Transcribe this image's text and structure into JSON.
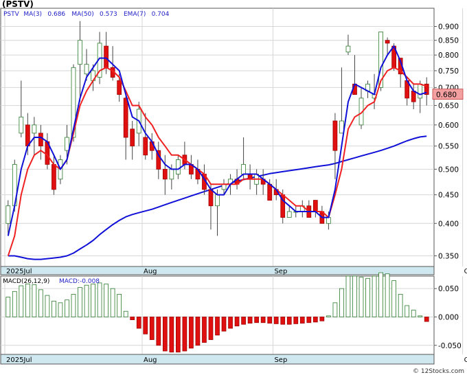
{
  "chart_data": [
    {
      "type": "candlestick",
      "title": "(PSTV)",
      "indicator_legend": [
        {
          "label": "PSTV",
          "color": "#1c1cc8"
        },
        {
          "label": "MA(3)",
          "color": "#1c1cc8"
        },
        {
          "label": "0.686",
          "color": "#1c1cc8"
        },
        {
          "label": "MA(50)",
          "color": "#1c1cc8"
        },
        {
          "label": "0.573",
          "color": "#1c1cc8"
        },
        {
          "label": "EMA(7)",
          "color": "#1c1cc8"
        },
        {
          "label": "0.704",
          "color": "#1c1cc8"
        }
      ],
      "x_tick_labels": [
        {
          "label": "2025Jul",
          "index": 0
        },
        {
          "label": "Aug",
          "index": 21
        },
        {
          "label": "Sep",
          "index": 41
        },
        {
          "label": "Oct",
          "index": 70
        }
      ],
      "y_ticks": [
        0.35,
        0.4,
        0.45,
        0.5,
        0.55,
        0.6,
        0.65,
        0.7,
        0.75,
        0.8,
        0.85,
        0.9
      ],
      "y_tick_labels": [
        "0.350",
        "0.400",
        "0.450",
        "0.500",
        "0.550",
        "0.600",
        "0.650",
        "0.700",
        "0.750",
        "0.800",
        "0.850",
        "0.900"
      ],
      "y_scale": "log",
      "ylim": [
        0.335,
        0.97
      ],
      "last_price_label": "0.680",
      "colors": {
        "up": "#ffffff",
        "down": "#e01010",
        "wick": "#444444",
        "ma50": "#1010d8",
        "ma_short": "#1010d8",
        "ema": "#f02020",
        "last_price_bg": "#f4a0a0"
      },
      "candles": [
        [
          0.4,
          0.44,
          0.38,
          0.43
        ],
        [
          0.43,
          0.52,
          0.42,
          0.51
        ],
        [
          0.58,
          0.72,
          0.57,
          0.62
        ],
        [
          0.6,
          0.63,
          0.53,
          0.55
        ],
        [
          0.58,
          0.62,
          0.53,
          0.6
        ],
        [
          0.58,
          0.6,
          0.52,
          0.55
        ],
        [
          0.56,
          0.58,
          0.5,
          0.51
        ],
        [
          0.51,
          0.53,
          0.45,
          0.46
        ],
        [
          0.48,
          0.53,
          0.47,
          0.52
        ],
        [
          0.54,
          0.6,
          0.51,
          0.57
        ],
        [
          0.57,
          0.77,
          0.56,
          0.76
        ],
        [
          0.77,
          0.92,
          0.66,
          0.85
        ],
        [
          0.74,
          0.82,
          0.72,
          0.77
        ],
        [
          0.72,
          0.77,
          0.69,
          0.75
        ],
        [
          0.73,
          0.88,
          0.71,
          0.84
        ],
        [
          0.83,
          0.88,
          0.74,
          0.76
        ],
        [
          0.76,
          0.83,
          0.72,
          0.73
        ],
        [
          0.72,
          0.74,
          0.66,
          0.68
        ],
        [
          0.67,
          0.69,
          0.52,
          0.57
        ],
        [
          0.59,
          0.61,
          0.52,
          0.55
        ],
        [
          0.58,
          0.66,
          0.55,
          0.64
        ],
        [
          0.57,
          0.63,
          0.52,
          0.53
        ],
        [
          0.56,
          0.58,
          0.52,
          0.54
        ],
        [
          0.54,
          0.56,
          0.48,
          0.5
        ],
        [
          0.5,
          0.53,
          0.45,
          0.48
        ],
        [
          0.48,
          0.51,
          0.46,
          0.5
        ],
        [
          0.49,
          0.53,
          0.48,
          0.52
        ],
        [
          0.53,
          0.56,
          0.5,
          0.51
        ],
        [
          0.51,
          0.53,
          0.48,
          0.49
        ],
        [
          0.5,
          0.52,
          0.47,
          0.48
        ],
        [
          0.49,
          0.51,
          0.45,
          0.46
        ],
        [
          0.46,
          0.47,
          0.39,
          0.43
        ],
        [
          0.43,
          0.46,
          0.38,
          0.45
        ],
        [
          0.46,
          0.48,
          0.45,
          0.47
        ],
        [
          0.47,
          0.49,
          0.45,
          0.48
        ],
        [
          0.48,
          0.5,
          0.46,
          0.47
        ],
        [
          0.49,
          0.57,
          0.48,
          0.51
        ],
        [
          0.49,
          0.51,
          0.46,
          0.48
        ],
        [
          0.47,
          0.5,
          0.45,
          0.49
        ],
        [
          0.48,
          0.5,
          0.45,
          0.47
        ],
        [
          0.47,
          0.48,
          0.44,
          0.44
        ],
        [
          0.46,
          0.48,
          0.44,
          0.45
        ],
        [
          0.45,
          0.46,
          0.4,
          0.41
        ],
        [
          0.41,
          0.43,
          0.41,
          0.42
        ],
        [
          0.42,
          0.43,
          0.41,
          0.42
        ],
        [
          0.42,
          0.44,
          0.41,
          0.43
        ],
        [
          0.43,
          0.44,
          0.41,
          0.41
        ],
        [
          0.44,
          0.44,
          0.41,
          0.42
        ],
        [
          0.42,
          0.43,
          0.4,
          0.4
        ],
        [
          0.4,
          0.42,
          0.39,
          0.41
        ],
        [
          0.61,
          0.63,
          0.48,
          0.54
        ],
        [
          0.58,
          0.76,
          0.58,
          0.61
        ],
        [
          0.81,
          0.87,
          0.8,
          0.83
        ],
        [
          0.71,
          0.8,
          0.68,
          0.68
        ],
        [
          0.6,
          0.7,
          0.59,
          0.67
        ],
        [
          0.69,
          0.72,
          0.67,
          0.71
        ],
        [
          0.67,
          0.74,
          0.64,
          0.68
        ],
        [
          0.7,
          0.88,
          0.69,
          0.88
        ],
        [
          0.85,
          0.86,
          0.8,
          0.84
        ],
        [
          0.83,
          0.84,
          0.75,
          0.76
        ],
        [
          0.79,
          0.79,
          0.7,
          0.74
        ],
        [
          0.72,
          0.72,
          0.65,
          0.67
        ],
        [
          0.69,
          0.71,
          0.64,
          0.66
        ],
        [
          0.67,
          0.72,
          0.63,
          0.71
        ],
        [
          0.71,
          0.73,
          0.65,
          0.68
        ]
      ],
      "ma50": [
        0.35,
        0.35,
        0.348,
        0.346,
        0.345,
        0.345,
        0.346,
        0.347,
        0.348,
        0.35,
        0.354,
        0.36,
        0.366,
        0.373,
        0.382,
        0.39,
        0.398,
        0.405,
        0.411,
        0.415,
        0.418,
        0.421,
        0.424,
        0.428,
        0.432,
        0.436,
        0.44,
        0.444,
        0.448,
        0.452,
        0.456,
        0.46,
        0.464,
        0.468,
        0.472,
        0.476,
        0.479,
        0.482,
        0.485,
        0.488,
        0.491,
        0.493,
        0.495,
        0.497,
        0.499,
        0.501,
        0.503,
        0.505,
        0.507,
        0.509,
        0.512,
        0.516,
        0.52,
        0.524,
        0.528,
        0.532,
        0.536,
        0.54,
        0.545,
        0.55,
        0.556,
        0.562,
        0.567,
        0.571,
        0.573
      ],
      "ma3": [
        0.38,
        0.43,
        0.5,
        0.55,
        0.57,
        0.57,
        0.56,
        0.53,
        0.5,
        0.52,
        0.59,
        0.67,
        0.73,
        0.76,
        0.79,
        0.79,
        0.77,
        0.75,
        0.68,
        0.62,
        0.61,
        0.58,
        0.56,
        0.53,
        0.51,
        0.5,
        0.5,
        0.51,
        0.51,
        0.5,
        0.48,
        0.46,
        0.45,
        0.45,
        0.47,
        0.48,
        0.49,
        0.49,
        0.49,
        0.48,
        0.47,
        0.46,
        0.44,
        0.43,
        0.42,
        0.42,
        0.42,
        0.42,
        0.41,
        0.41,
        0.46,
        0.55,
        0.66,
        0.71,
        0.7,
        0.69,
        0.68,
        0.76,
        0.8,
        0.83,
        0.78,
        0.72,
        0.69,
        0.68,
        0.686
      ],
      "ema7": [
        0.35,
        0.38,
        0.45,
        0.5,
        0.53,
        0.54,
        0.53,
        0.51,
        0.5,
        0.52,
        0.58,
        0.65,
        0.69,
        0.72,
        0.75,
        0.76,
        0.75,
        0.73,
        0.69,
        0.65,
        0.65,
        0.62,
        0.6,
        0.57,
        0.55,
        0.53,
        0.53,
        0.52,
        0.51,
        0.5,
        0.49,
        0.47,
        0.47,
        0.47,
        0.47,
        0.47,
        0.48,
        0.48,
        0.48,
        0.48,
        0.47,
        0.46,
        0.45,
        0.44,
        0.43,
        0.43,
        0.42,
        0.42,
        0.42,
        0.41,
        0.45,
        0.5,
        0.59,
        0.62,
        0.63,
        0.65,
        0.66,
        0.72,
        0.75,
        0.76,
        0.75,
        0.73,
        0.71,
        0.71,
        0.704
      ]
    },
    {
      "type": "bar",
      "title": "MACD(26,12,9)",
      "legend_value": "MACD:-0.008",
      "y_ticks": [
        -0.05,
        0.0,
        0.05
      ],
      "y_tick_labels": [
        "-0.050",
        "0.000",
        "0.050"
      ],
      "ylim": [
        -0.066,
        0.072
      ],
      "colors": {
        "positive": "#2a7a2a",
        "negative": "#e01010"
      },
      "values": [
        0.035,
        0.045,
        0.055,
        0.058,
        0.057,
        0.048,
        0.038,
        0.028,
        0.025,
        0.03,
        0.04,
        0.052,
        0.056,
        0.058,
        0.06,
        0.058,
        0.05,
        0.04,
        0.01,
        -0.005,
        -0.02,
        -0.03,
        -0.04,
        -0.05,
        -0.06,
        -0.062,
        -0.062,
        -0.06,
        -0.055,
        -0.05,
        -0.045,
        -0.04,
        -0.032,
        -0.025,
        -0.02,
        -0.016,
        -0.013,
        -0.011,
        -0.01,
        -0.01,
        -0.011,
        -0.012,
        -0.013,
        -0.013,
        -0.012,
        -0.011,
        -0.01,
        -0.009,
        -0.007,
        0.002,
        0.025,
        0.05,
        0.072,
        0.072,
        0.07,
        0.068,
        0.072,
        0.078,
        0.076,
        0.064,
        0.04,
        0.02,
        0.012,
        0.002,
        -0.008
      ]
    }
  ],
  "watermark": "© 12Stocks.com"
}
